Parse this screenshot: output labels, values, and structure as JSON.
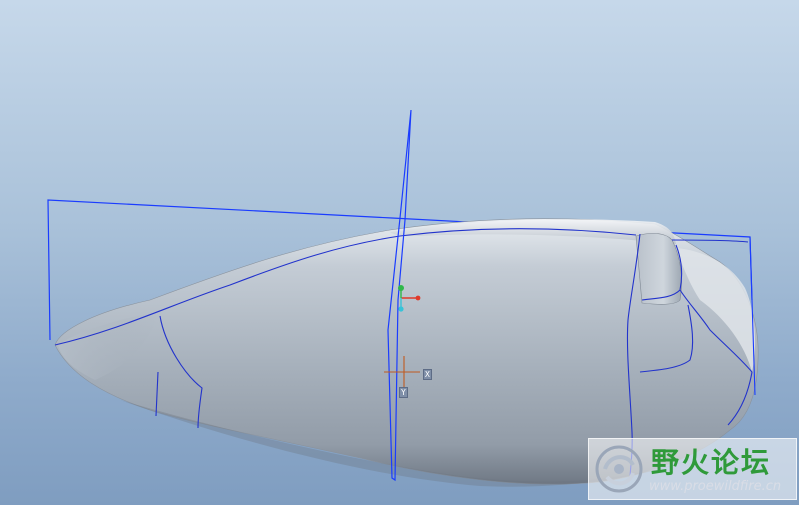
{
  "viewport": {
    "background_top": "#c6d8ea",
    "background_bottom": "#7f9dc0"
  },
  "model": {
    "body_color": "#aab3bd",
    "edge_color": "#2233cc",
    "datum_color": "#1a3cff"
  },
  "csys": {
    "x_color": "#e03a2a",
    "y_color": "#2fb84a",
    "z_color": "#37c3d8",
    "origin_color": "#c05a20"
  },
  "watermark": {
    "title": "野火论坛",
    "url": "www.proewildfire.cn",
    "title_color": "#2f9a3a"
  }
}
